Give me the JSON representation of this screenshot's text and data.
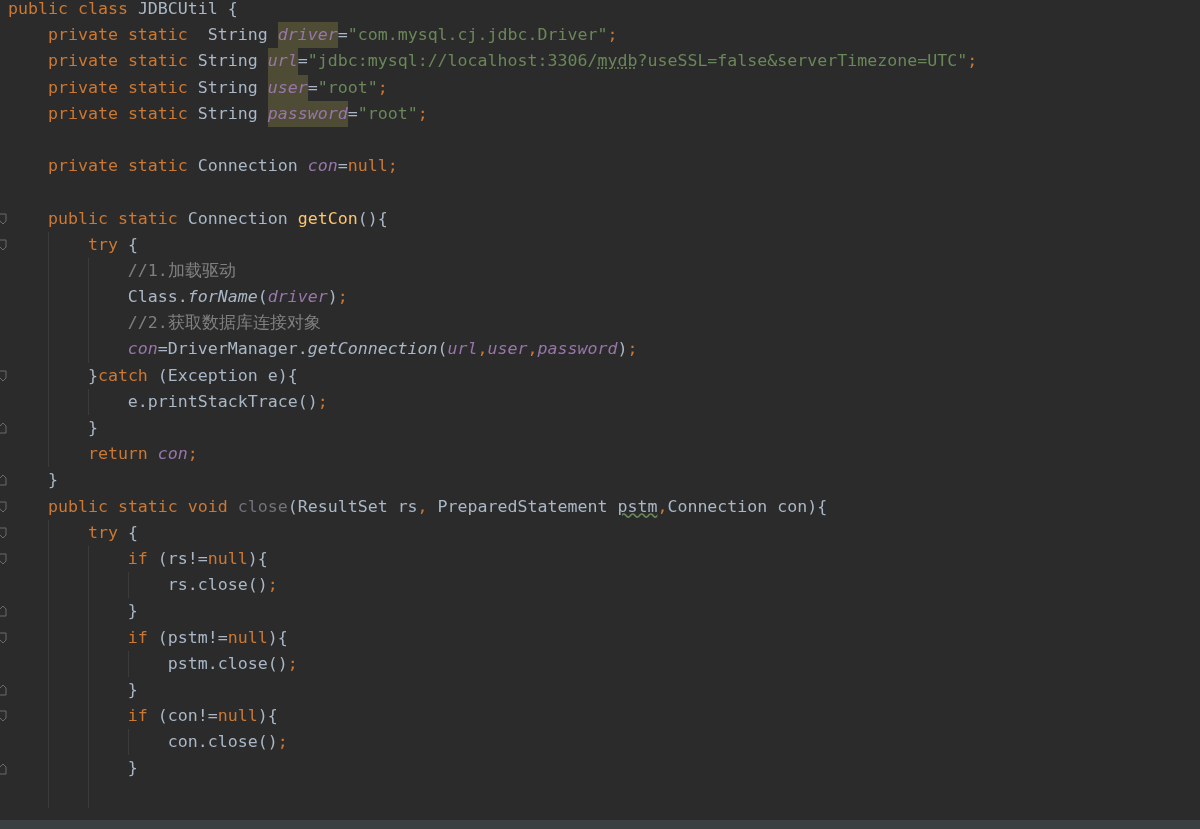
{
  "editor": {
    "lines": [
      {
        "kind": "code",
        "tokens": [
          {
            "kind": "kw",
            "text": "public class "
          },
          {
            "kind": "plain",
            "text": "JDBCUtil {"
          }
        ],
        "children": [
          {
            "kind": "code",
            "tokens": [
              {
                "kind": "kw",
                "text": "private static"
              },
              {
                "kind": "plain",
                "text": "  String "
              },
              {
                "kind": "field_hl",
                "text": "driver"
              },
              {
                "kind": "plain",
                "text": "="
              },
              {
                "kind": "str",
                "text": "\"com.mysql.cj.jdbc.Driver\""
              },
              {
                "kind": "punct",
                "text": ";"
              }
            ]
          },
          {
            "kind": "code",
            "tokens": [
              {
                "kind": "kw",
                "text": "private static"
              },
              {
                "kind": "plain",
                "text": " String "
              },
              {
                "kind": "field_hl",
                "text": "url"
              },
              {
                "kind": "plain",
                "text": "="
              },
              {
                "kind": "str",
                "text": "\"jdbc:mysql://localhost:3306/"
              },
              {
                "kind": "str_typo",
                "text": "mydb"
              },
              {
                "kind": "str",
                "text": "?useSSL=false&serverTimezone=UTC\""
              },
              {
                "kind": "punct",
                "text": ";"
              }
            ]
          },
          {
            "kind": "code",
            "tokens": [
              {
                "kind": "kw",
                "text": "private static"
              },
              {
                "kind": "plain",
                "text": " String "
              },
              {
                "kind": "field_hl",
                "text": "user"
              },
              {
                "kind": "plain",
                "text": "="
              },
              {
                "kind": "str",
                "text": "\"root\""
              },
              {
                "kind": "punct",
                "text": ";"
              }
            ]
          },
          {
            "kind": "code",
            "tokens": [
              {
                "kind": "kw",
                "text": "private static"
              },
              {
                "kind": "plain",
                "text": " String "
              },
              {
                "kind": "field_hl",
                "text": "password"
              },
              {
                "kind": "plain",
                "text": "="
              },
              {
                "kind": "str",
                "text": "\"root\""
              },
              {
                "kind": "punct",
                "text": ";"
              }
            ]
          },
          {
            "kind": "blank"
          },
          {
            "kind": "code",
            "tokens": [
              {
                "kind": "kw",
                "text": "private static"
              },
              {
                "kind": "plain",
                "text": " Connection "
              },
              {
                "kind": "field",
                "text": "con"
              },
              {
                "kind": "plain",
                "text": "="
              },
              {
                "kind": "kw",
                "text": "null"
              },
              {
                "kind": "punct",
                "text": ";"
              }
            ]
          },
          {
            "kind": "blank"
          },
          {
            "kind": "code",
            "fold": {
              "kind": "open"
            },
            "tokens": [
              {
                "kind": "kw",
                "text": "public static"
              },
              {
                "kind": "plain",
                "text": " Connection "
              },
              {
                "kind": "method",
                "text": "getCon"
              },
              {
                "kind": "plain",
                "text": "(){"
              }
            ],
            "children": [
              {
                "kind": "code",
                "fold": {
                  "kind": "open"
                },
                "tokens": [
                  {
                    "kind": "kw",
                    "text": "try"
                  },
                  {
                    "kind": "plain",
                    "text": " {"
                  }
                ],
                "children": [
                  {
                    "kind": "code",
                    "tokens": [
                      {
                        "kind": "comment",
                        "text": "//1.加载驱动"
                      }
                    ]
                  },
                  {
                    "kind": "code",
                    "tokens": [
                      {
                        "kind": "plain",
                        "text": "Class."
                      },
                      {
                        "kind": "call",
                        "text": "forName"
                      },
                      {
                        "kind": "plain",
                        "text": "("
                      },
                      {
                        "kind": "field",
                        "text": "driver"
                      },
                      {
                        "kind": "plain",
                        "text": ")"
                      },
                      {
                        "kind": "punct",
                        "text": ";"
                      }
                    ]
                  },
                  {
                    "kind": "code",
                    "tokens": [
                      {
                        "kind": "comment",
                        "text": "//2.获取数据库连接对象"
                      }
                    ]
                  },
                  {
                    "kind": "code",
                    "tokens": [
                      {
                        "kind": "field",
                        "text": "con"
                      },
                      {
                        "kind": "plain",
                        "text": "=DriverManager."
                      },
                      {
                        "kind": "call",
                        "text": "getConnection"
                      },
                      {
                        "kind": "plain",
                        "text": "("
                      },
                      {
                        "kind": "field",
                        "text": "url"
                      },
                      {
                        "kind": "punct",
                        "text": ","
                      },
                      {
                        "kind": "field",
                        "text": "user"
                      },
                      {
                        "kind": "punct",
                        "text": ","
                      },
                      {
                        "kind": "field",
                        "text": "password"
                      },
                      {
                        "kind": "plain",
                        "text": ")"
                      },
                      {
                        "kind": "punct",
                        "text": ";"
                      }
                    ]
                  }
                ]
              },
              {
                "kind": "code",
                "fold": {
                  "kind": "open"
                },
                "tokens": [
                  {
                    "kind": "plain",
                    "text": "}"
                  },
                  {
                    "kind": "kw",
                    "text": "catch"
                  },
                  {
                    "kind": "plain",
                    "text": " (Exception e){"
                  }
                ],
                "children": [
                  {
                    "kind": "code",
                    "tokens": [
                      {
                        "kind": "plain",
                        "text": "e.printStackTrace()"
                      },
                      {
                        "kind": "punct",
                        "text": ";"
                      }
                    ]
                  }
                ]
              },
              {
                "kind": "code",
                "fold": {
                  "kind": "close"
                },
                "tokens": [
                  {
                    "kind": "plain",
                    "text": "}"
                  }
                ]
              },
              {
                "kind": "code",
                "tokens": [
                  {
                    "kind": "kw",
                    "text": "return "
                  },
                  {
                    "kind": "field",
                    "text": "con"
                  },
                  {
                    "kind": "punct",
                    "text": ";"
                  }
                ]
              }
            ]
          },
          {
            "kind": "code",
            "fold": {
              "kind": "close"
            },
            "tokens": [
              {
                "kind": "plain",
                "text": "}"
              }
            ]
          },
          {
            "kind": "code",
            "fold": {
              "kind": "open"
            },
            "tokens": [
              {
                "kind": "kw",
                "text": "public static void "
              },
              {
                "kind": "unused",
                "text": "close"
              },
              {
                "kind": "plain",
                "text": "(ResultSet rs"
              },
              {
                "kind": "punct",
                "text": ","
              },
              {
                "kind": "plain",
                "text": " PreparedStatement "
              },
              {
                "kind": "plain_typo",
                "text": "pstm"
              },
              {
                "kind": "punct",
                "text": ","
              },
              {
                "kind": "plain",
                "text": "Connection con){"
              }
            ],
            "children": [
              {
                "kind": "code",
                "fold": {
                  "kind": "open"
                },
                "tokens": [
                  {
                    "kind": "kw",
                    "text": "try"
                  },
                  {
                    "kind": "plain",
                    "text": " {"
                  }
                ],
                "children": [
                  {
                    "kind": "code",
                    "fold": {
                      "kind": "open"
                    },
                    "tokens": [
                      {
                        "kind": "kw",
                        "text": "if"
                      },
                      {
                        "kind": "plain",
                        "text": " (rs!="
                      },
                      {
                        "kind": "kw",
                        "text": "null"
                      },
                      {
                        "kind": "plain",
                        "text": "){"
                      }
                    ],
                    "children": [
                      {
                        "kind": "code",
                        "tokens": [
                          {
                            "kind": "plain",
                            "text": "rs.close()"
                          },
                          {
                            "kind": "punct",
                            "text": ";"
                          }
                        ]
                      }
                    ]
                  },
                  {
                    "kind": "code",
                    "fold": {
                      "kind": "close"
                    },
                    "tokens": [
                      {
                        "kind": "plain",
                        "text": "}"
                      }
                    ]
                  },
                  {
                    "kind": "code",
                    "fold": {
                      "kind": "open"
                    },
                    "tokens": [
                      {
                        "kind": "kw",
                        "text": "if"
                      },
                      {
                        "kind": "plain",
                        "text": " (pstm!="
                      },
                      {
                        "kind": "kw",
                        "text": "null"
                      },
                      {
                        "kind": "plain",
                        "text": "){"
                      }
                    ],
                    "children": [
                      {
                        "kind": "code",
                        "tokens": [
                          {
                            "kind": "plain",
                            "text": "pstm.close()"
                          },
                          {
                            "kind": "punct",
                            "text": ";"
                          }
                        ]
                      }
                    ]
                  },
                  {
                    "kind": "code",
                    "fold": {
                      "kind": "close"
                    },
                    "tokens": [
                      {
                        "kind": "plain",
                        "text": "}"
                      }
                    ]
                  },
                  {
                    "kind": "code",
                    "fold": {
                      "kind": "open"
                    },
                    "tokens": [
                      {
                        "kind": "kw",
                        "text": "if"
                      },
                      {
                        "kind": "plain",
                        "text": " (con!="
                      },
                      {
                        "kind": "kw",
                        "text": "null"
                      },
                      {
                        "kind": "plain",
                        "text": "){"
                      }
                    ],
                    "children": [
                      {
                        "kind": "code",
                        "tokens": [
                          {
                            "kind": "plain",
                            "text": "con.close()"
                          },
                          {
                            "kind": "punct",
                            "text": ";"
                          }
                        ]
                      }
                    ]
                  },
                  {
                    "kind": "code",
                    "fold": {
                      "kind": "close"
                    },
                    "tokens": [
                      {
                        "kind": "plain",
                        "text": "}"
                      }
                    ]
                  },
                  {
                    "kind": "blank"
                  }
                ]
              }
            ]
          }
        ]
      }
    ]
  }
}
